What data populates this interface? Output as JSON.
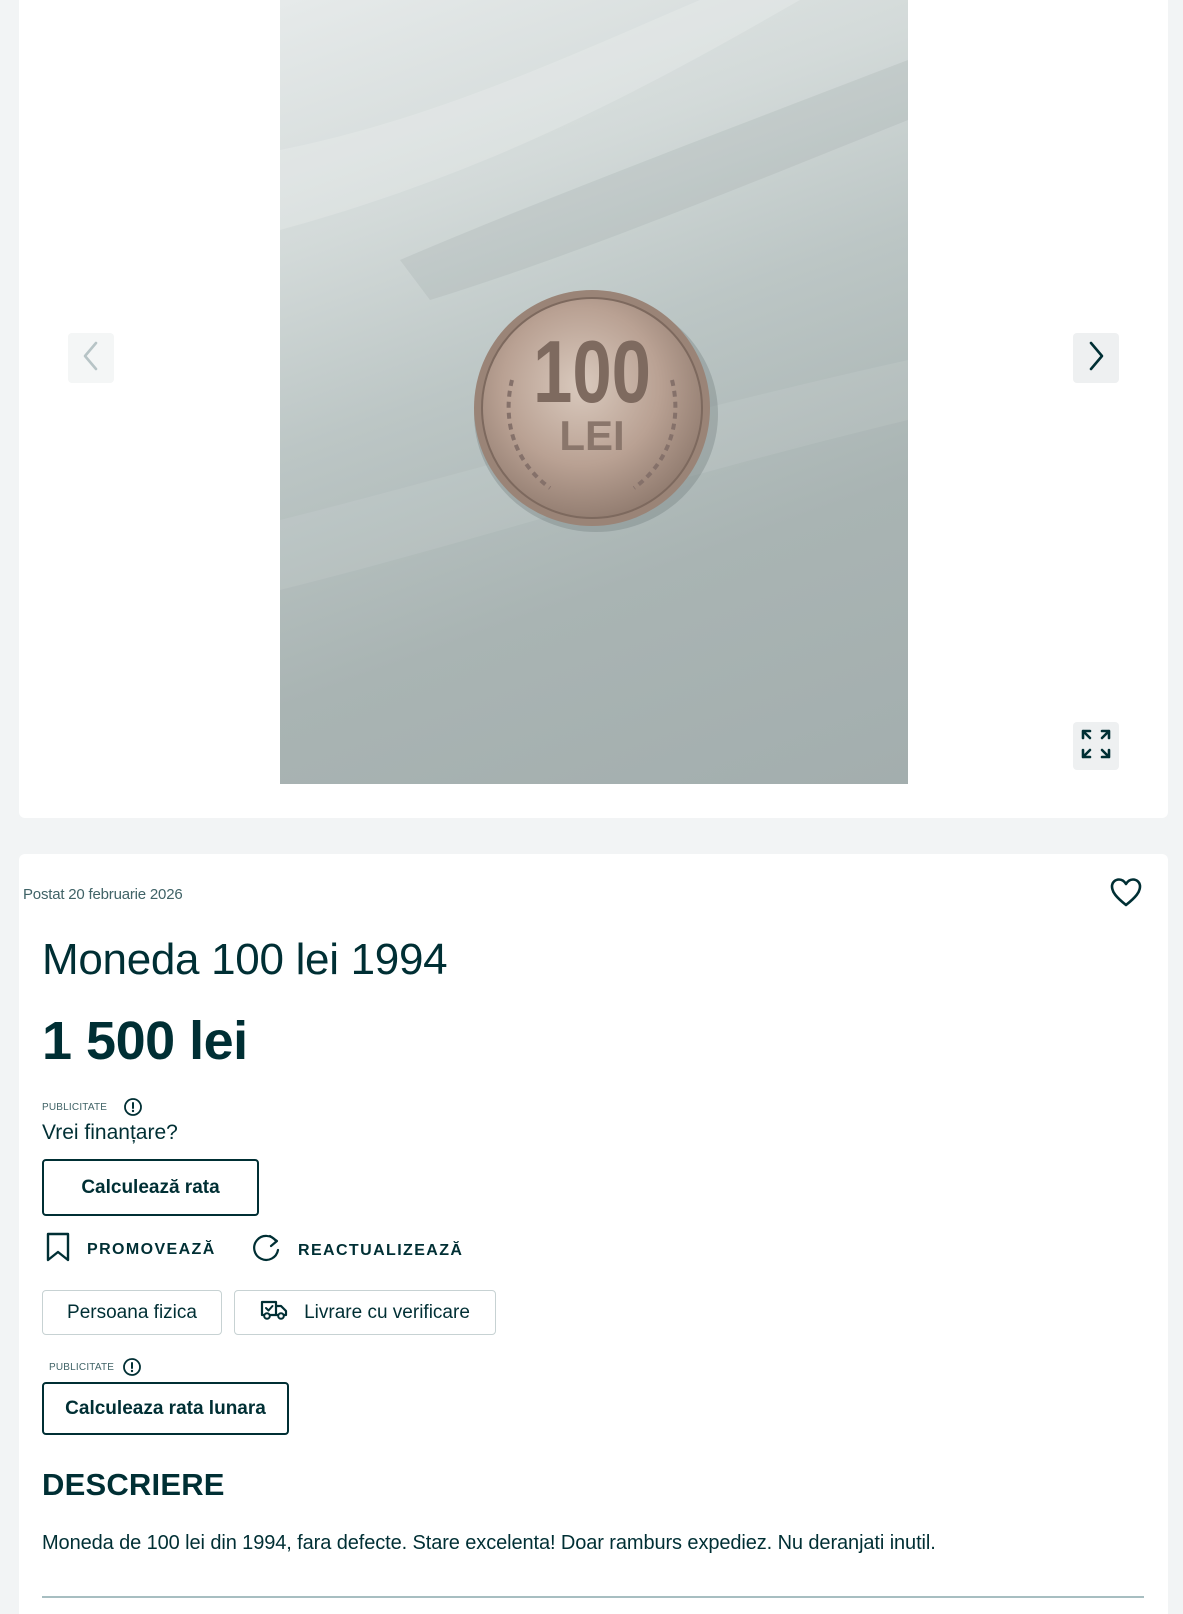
{
  "gallery": {
    "coin_value": "100",
    "coin_currency": "LEI",
    "icons": {
      "prev": "chevron-left-icon",
      "next": "chevron-right-icon",
      "expand": "expand-icon"
    }
  },
  "listing": {
    "posted": "Postat 20 februarie 2026",
    "title": "Moneda 100 lei 1994",
    "price": "1 500 lei",
    "favorite_icon": "heart-icon"
  },
  "financing": {
    "ad_label": "PUBLICITATE",
    "question": "Vrei finanțare?",
    "button_label": "Calculează rata"
  },
  "actions": {
    "promote_label": "PROMOVEAZĂ",
    "refresh_label": "REACTUALIZEAZĂ"
  },
  "tags": {
    "seller_type": "Persoana fizica",
    "delivery": "Livrare cu verificare"
  },
  "monthly": {
    "ad_label": "PUBLICITATE",
    "button_label": "Calculeaza rata lunara"
  },
  "description": {
    "heading": "DESCRIERE",
    "text": "Moneda de 100 lei din 1994, fara defecte. Stare excelenta! Doar ramburs expediez. Nu deranjati inutil."
  },
  "colors": {
    "primary_text": "#002f34",
    "secondary_text": "#406367",
    "page_background": "#f2f4f5",
    "card_background": "#ffffff"
  }
}
